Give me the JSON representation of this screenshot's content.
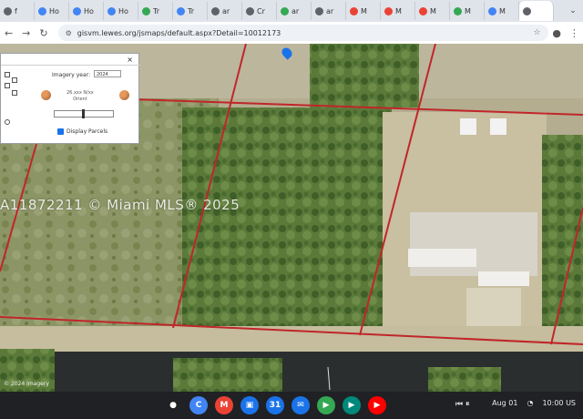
{
  "browser": {
    "tabs": [
      {
        "label": "f",
        "color": "#5f6368"
      },
      {
        "label": "Ho",
        "color": "#4285f4"
      },
      {
        "label": "Ho",
        "color": "#4285f4"
      },
      {
        "label": "Ho",
        "color": "#4285f4"
      },
      {
        "label": "Tr",
        "color": "#34a853"
      },
      {
        "label": "Tr",
        "color": "#4285f4"
      },
      {
        "label": "ar",
        "color": "#5f6368"
      },
      {
        "label": "Cr",
        "color": "#5f6368"
      },
      {
        "label": "ar",
        "color": "#34a853"
      },
      {
        "label": "ar",
        "color": "#5f6368"
      },
      {
        "label": "M",
        "color": "#ea4335"
      },
      {
        "label": "M",
        "color": "#ea4335"
      },
      {
        "label": "M",
        "color": "#ea4335"
      },
      {
        "label": "M",
        "color": "#34a853"
      },
      {
        "label": "M",
        "color": "#4285f4"
      },
      {
        "label": "",
        "color": "#5f6368",
        "active": true
      }
    ],
    "url": "gisvm.lewes.org/jsmaps/default.aspx?Detail=10012173"
  },
  "panel": {
    "close_label": "×",
    "imagery_label": "Imagery year:",
    "imagery_value": "2024",
    "coords_line1": "26.xxx N/xx",
    "coords_line2": "Orient",
    "checkbox_label": "Display Parcels"
  },
  "map": {
    "watermark": "A11872211 © Miami MLS® 2025",
    "imagery_credit": "© 2024 Imagery",
    "parcel_line_color": "#c0262a"
  },
  "shelf": {
    "apps": [
      {
        "name": "launcher",
        "glyph": "●",
        "color": "#202124"
      },
      {
        "name": "chrome",
        "glyph": "C",
        "color": "#4285f4"
      },
      {
        "name": "gmail",
        "glyph": "M",
        "color": "#ea4335"
      },
      {
        "name": "files",
        "glyph": "▣",
        "color": "#1a73e8"
      },
      {
        "name": "calendar",
        "glyph": "31",
        "color": "#1a73e8"
      },
      {
        "name": "messages",
        "glyph": "✉",
        "color": "#1a73e8"
      },
      {
        "name": "play-store",
        "glyph": "▶",
        "color": "#34a853"
      },
      {
        "name": "meet",
        "glyph": "▶",
        "color": "#00897b"
      },
      {
        "name": "youtube",
        "glyph": "▶",
        "color": "#ff0000"
      }
    ],
    "date": "Aug 01",
    "time": "10:00 US"
  }
}
